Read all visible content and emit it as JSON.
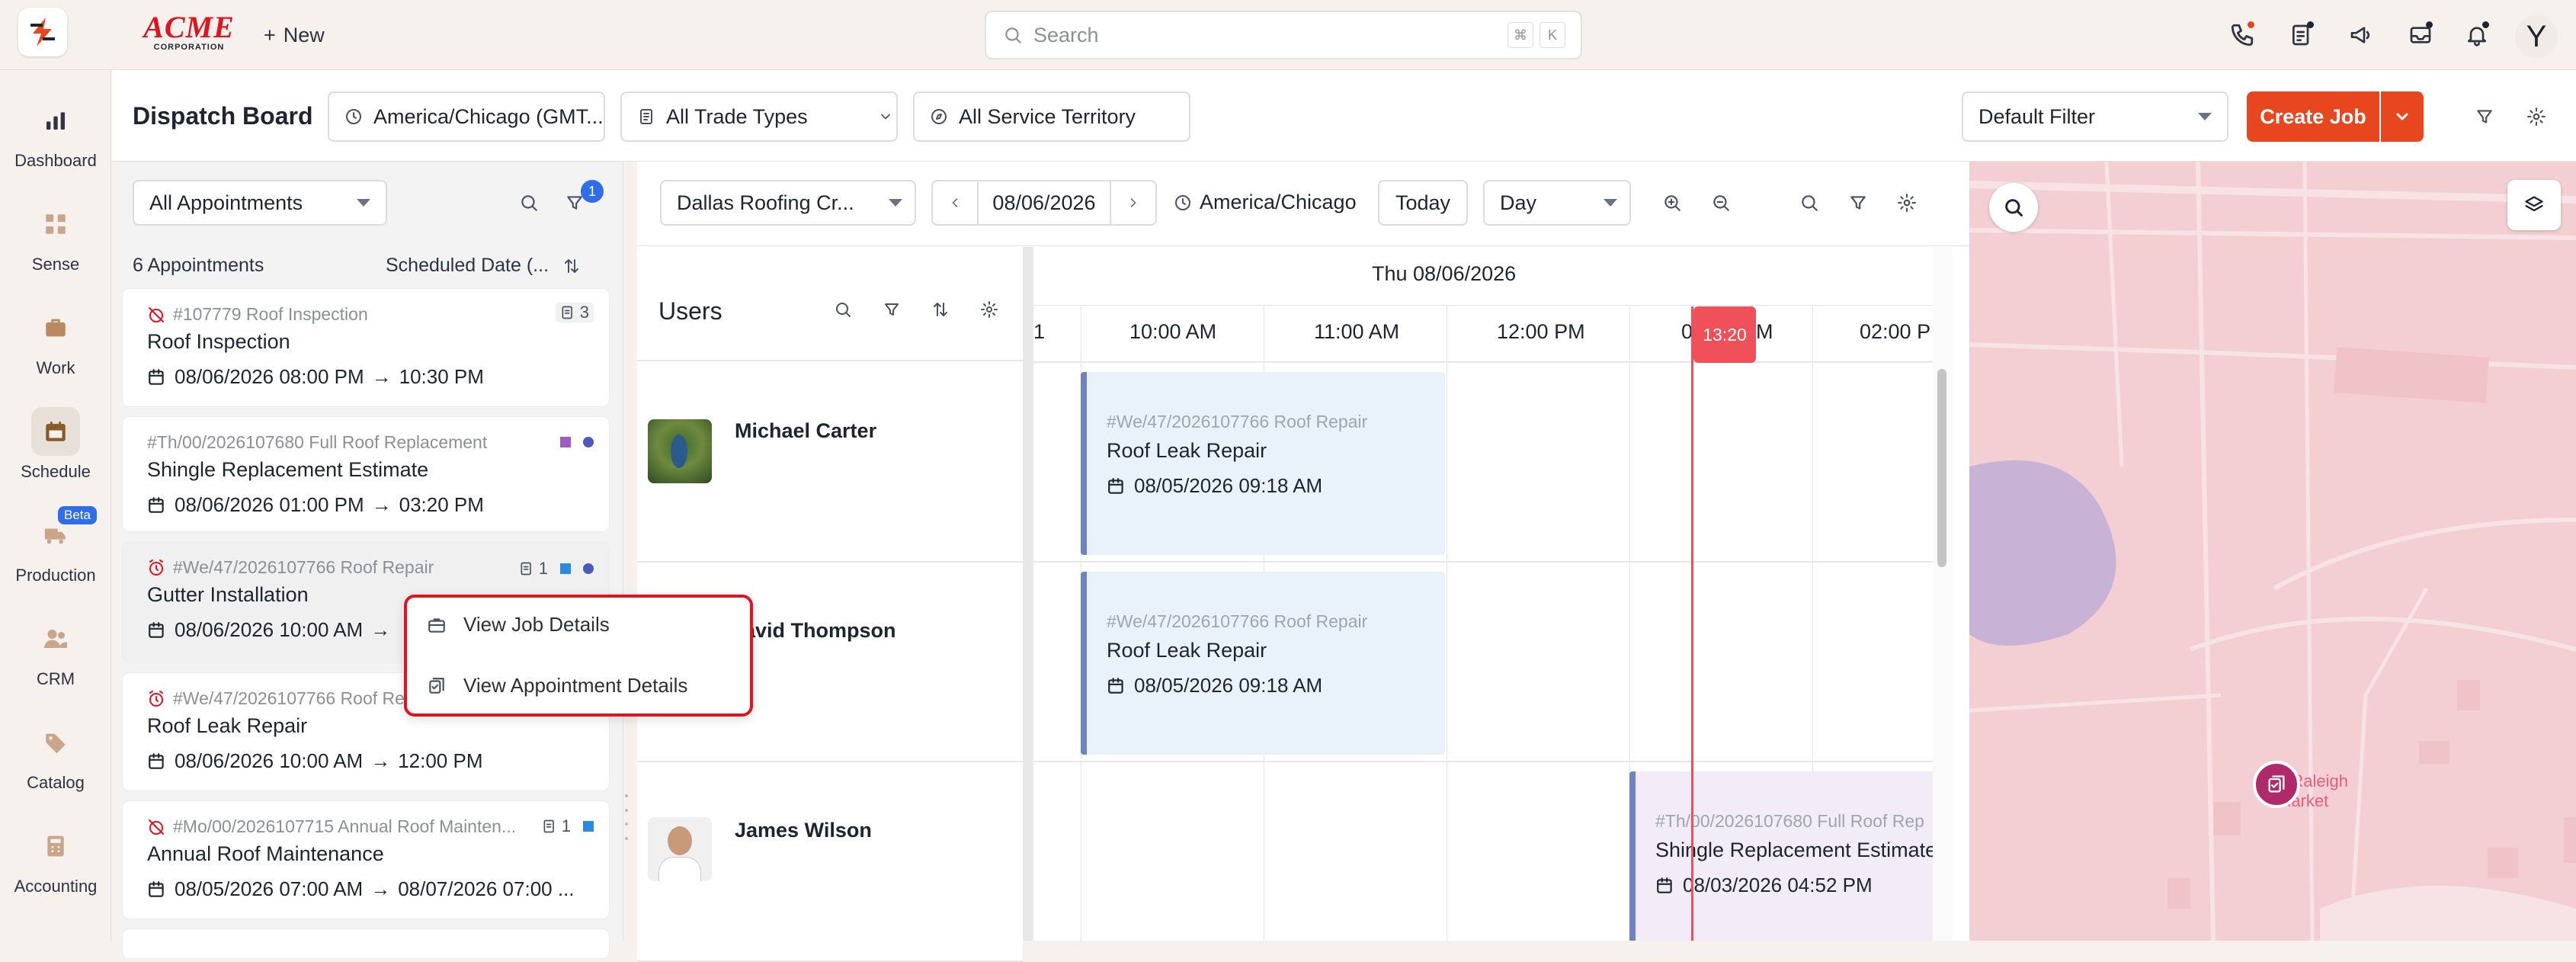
{
  "app": {
    "logo_text": "ACME",
    "logo_sub": "CORPORATION",
    "new_label": "New",
    "search_placeholder": "Search",
    "search_kbd_1": "⌘",
    "search_kbd_2": "K",
    "avatar_initial": "Y"
  },
  "sidebar": {
    "items": [
      {
        "label": "Dashboard",
        "icon": "bar-chart-icon"
      },
      {
        "label": "Sense",
        "icon": "grid-icon"
      },
      {
        "label": "Work",
        "icon": "briefcase-icon"
      },
      {
        "label": "Schedule",
        "icon": "calendar-icon"
      },
      {
        "label": "Production",
        "icon": "truck-icon",
        "badge": "Beta"
      },
      {
        "label": "CRM",
        "icon": "users-icon"
      },
      {
        "label": "Catalog",
        "icon": "tag-icon"
      },
      {
        "label": "Accounting",
        "icon": "calculator-icon"
      }
    ]
  },
  "header": {
    "title": "Dispatch Board",
    "timezone": "America/Chicago (GMT...",
    "trade_types": "All Trade Types",
    "service_territory": "All Service Territory",
    "filter_select": "Default Filter",
    "create_job": "Create Job"
  },
  "leftpanel": {
    "filter": "All Appointments",
    "filter_badge": "1",
    "count_label": "6 Appointments",
    "sort_label": "Scheduled Date (...",
    "cards": [
      {
        "ref": "#107779 Roof Inspection",
        "title": "Roof Inspection",
        "start": "08/06/2026 08:00 PM",
        "end": "10:30 PM",
        "count": "3"
      },
      {
        "ref": "#Th/00/2026107680 Full Roof Replacement",
        "title": "Shingle Replacement Estimate",
        "start": "08/06/2026 01:00 PM",
        "end": "03:20 PM"
      },
      {
        "ref": "#We/47/2026107766 Roof Repair",
        "title": "Gutter Installation",
        "start": "08/06/2026 10:00 AM",
        "end": "",
        "count": "1"
      },
      {
        "ref": "#We/47/2026107766 Roof Repair",
        "title": "Roof Leak Repair",
        "start": "08/06/2026 10:00 AM",
        "end": "12:00 PM"
      },
      {
        "ref": "#Mo/00/2026107715 Annual Roof Mainten...",
        "title": "Annual Roof Maintenance",
        "start": "08/05/2026 07:00 AM",
        "end": "08/07/2026 07:00 ...",
        "count": "1"
      }
    ]
  },
  "context_menu": {
    "items": [
      "View Job Details",
      "View Appointment Details"
    ]
  },
  "schedule": {
    "crew": "Dallas Roofing Cr...",
    "date": "08/06/2026",
    "timezone": "America/Chicago",
    "today": "Today",
    "view": "Day",
    "users_title": "Users",
    "day_header": "Thu 08/06/2026",
    "times": [
      "1",
      "10:00 AM",
      "11:00 AM",
      "12:00 PM",
      "0",
      "M",
      "02:00 P"
    ],
    "now_label": "13:20",
    "users": [
      {
        "name": "Michael Carter"
      },
      {
        "name": "avid Thompson"
      },
      {
        "name": "James Wilson"
      }
    ],
    "appointments": [
      {
        "ref": "#We/47/2026107766 Roof Repair",
        "title": "Roof Leak Repair",
        "date": "08/05/2026 09:18 AM"
      },
      {
        "ref": "#We/47/2026107766 Roof Repair",
        "title": "Roof Leak Repair",
        "date": "08/05/2026 09:18 AM"
      },
      {
        "ref": "#Th/00/2026107680 Full Roof Rep",
        "title": "Shingle Replacement Estimate",
        "date": "08/03/2026 04:52 PM"
      }
    ]
  },
  "map": {
    "label_line1": "e Raleigh",
    "label_line2": "Market"
  },
  "colors": {
    "accent": "#e8461e",
    "now_line": "#f0505a",
    "map_bg": "#f3cfd3",
    "map_water": "#c8b3d6"
  }
}
